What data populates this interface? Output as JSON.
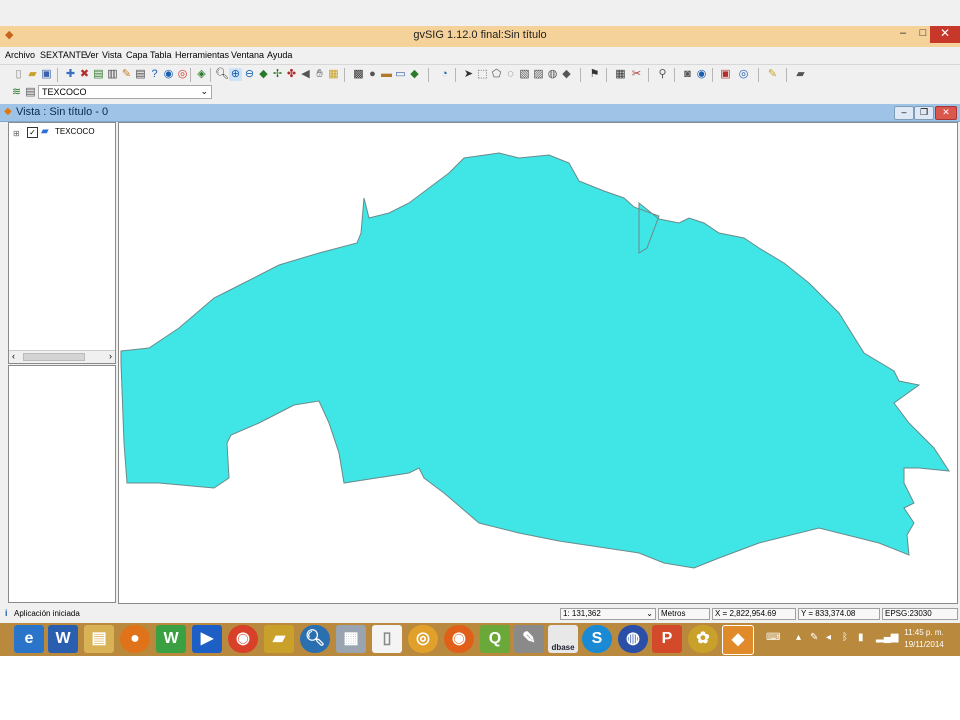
{
  "window": {
    "title": "gvSIG 1.12.0 final:Sin título",
    "minimize": "–",
    "maximize": "□",
    "close": "✕"
  },
  "menu": [
    "Archivo",
    "SEXTANTE",
    "Ver",
    "Vista",
    "Capa",
    "Tabla",
    "Herramientas",
    "Ventana",
    "Ayuda"
  ],
  "layer_selector": {
    "value": "TEXCOCO"
  },
  "view": {
    "title": "Vista : Sin título - 0"
  },
  "toc": {
    "layers": [
      {
        "name": "TEXCOCO",
        "visible": true
      }
    ]
  },
  "map": {
    "fill_color": "#40e6e6",
    "stroke_color": "#6a8a8a"
  },
  "status": {
    "message": "Aplicación iniciada",
    "scale": "1: 131,362",
    "units": "Metros",
    "x": "X = 2,822,954.69",
    "y": "Y = 833,374.08",
    "epsg": "EPSG:23030"
  },
  "taskbar": {
    "time": "11:45 p. m.",
    "date": "19/11/2014",
    "dbase_label": "dbase"
  },
  "colors": {
    "titlebar": "#f6d29b",
    "taskbar": "#b98a3d",
    "view_title": "#9ec3e6",
    "close": "#c7372a"
  }
}
